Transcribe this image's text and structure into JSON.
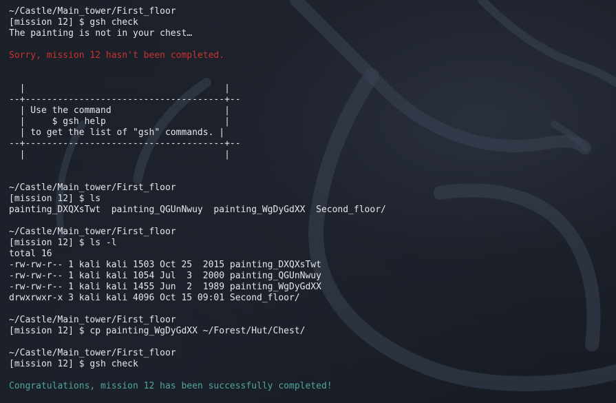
{
  "terminal": {
    "lines": [
      {
        "text": "~/Castle/Main_tower/First_floor",
        "kind": "path"
      },
      {
        "text": "[mission 12] $ gsh check",
        "kind": "prompt"
      },
      {
        "text": "The painting is not in your chest…",
        "kind": "output"
      },
      {
        "text": "",
        "kind": "blank"
      },
      {
        "text": "Sorry, mission 12 hasn't been completed.",
        "kind": "error"
      },
      {
        "text": "",
        "kind": "blank"
      },
      {
        "text": "",
        "kind": "blank"
      },
      {
        "text": "  |                                     |",
        "kind": "box"
      },
      {
        "text": "--+-------------------------------------+--",
        "kind": "box"
      },
      {
        "text": "  | Use the command                     |",
        "kind": "box"
      },
      {
        "text": "  |     $ gsh help                      |",
        "kind": "box"
      },
      {
        "text": "  | to get the list of \"gsh\" commands. |",
        "kind": "box"
      },
      {
        "text": "--+-------------------------------------+--",
        "kind": "box"
      },
      {
        "text": "  |                                     |",
        "kind": "box"
      },
      {
        "text": "",
        "kind": "blank"
      },
      {
        "text": "",
        "kind": "blank"
      },
      {
        "text": "~/Castle/Main_tower/First_floor",
        "kind": "path"
      },
      {
        "text": "[mission 12] $ ls",
        "kind": "prompt"
      },
      {
        "text": "painting_DXQXsTwt  painting_QGUnNwuy  painting_WgDyGdXX  Second_floor/",
        "kind": "output"
      },
      {
        "text": "",
        "kind": "blank"
      },
      {
        "text": "~/Castle/Main_tower/First_floor",
        "kind": "path"
      },
      {
        "text": "[mission 12] $ ls -l",
        "kind": "prompt"
      },
      {
        "text": "total 16",
        "kind": "output"
      },
      {
        "text": "-rw-rw-r-- 1 kali kali 1503 Oct 25  2015 painting_DXQXsTwt",
        "kind": "output"
      },
      {
        "text": "-rw-rw-r-- 1 kali kali 1054 Jul  3  2000 painting_QGUnNwuy",
        "kind": "output"
      },
      {
        "text": "-rw-rw-r-- 1 kali kali 1455 Jun  2  1989 painting_WgDyGdXX",
        "kind": "output"
      },
      {
        "text": "drwxrwxr-x 3 kali kali 4096 Oct 15 09:01 Second_floor/",
        "kind": "output"
      },
      {
        "text": "",
        "kind": "blank"
      },
      {
        "text": "~/Castle/Main_tower/First_floor",
        "kind": "path"
      },
      {
        "text": "[mission 12] $ cp painting_WgDyGdXX ~/Forest/Hut/Chest/",
        "kind": "prompt"
      },
      {
        "text": "",
        "kind": "blank"
      },
      {
        "text": "~/Castle/Main_tower/First_floor",
        "kind": "path"
      },
      {
        "text": "[mission 12] $ gsh check",
        "kind": "prompt"
      },
      {
        "text": "",
        "kind": "blank"
      },
      {
        "text": "Congratulations, mission 12 has been successfully completed!",
        "kind": "success"
      }
    ]
  },
  "colors": {
    "background": "#1b1f28",
    "text": "#e6e6e6",
    "error": "#c9342f",
    "success": "#4fa69b"
  },
  "background_icon": "kali-dragon-watermark"
}
